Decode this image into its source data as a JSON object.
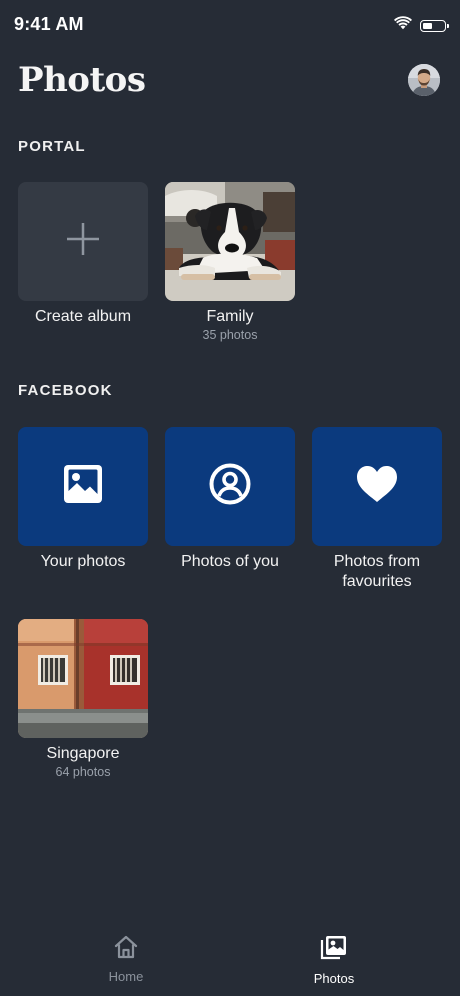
{
  "status_bar": {
    "time": "9:41 AM",
    "icons": [
      "wifi-icon",
      "battery-icon"
    ]
  },
  "header": {
    "title": "Photos",
    "avatar": "profile-avatar"
  },
  "portal": {
    "heading": "PORTAL",
    "tiles": [
      {
        "label": "Create album",
        "icon": "plus-icon"
      },
      {
        "label": "Family",
        "subtitle": "35 photos",
        "image": "dog-photo"
      }
    ]
  },
  "facebook": {
    "heading": "FACEBOOK",
    "tiles": [
      {
        "label": "Your photos",
        "icon": "image-icon"
      },
      {
        "label": "Photos of you",
        "icon": "person-circle-icon"
      },
      {
        "label": "Photos from favourites",
        "label_line1": "Photos from",
        "label_line2": "favourites",
        "icon": "heart-icon"
      },
      {
        "label": "Singapore",
        "subtitle": "64 photos",
        "image": "singapore-building-photo"
      }
    ]
  },
  "bottom_nav": {
    "items": [
      {
        "label": "Home",
        "icon": "home-icon",
        "active": false
      },
      {
        "label": "Photos",
        "icon": "photos-icon",
        "active": true
      }
    ]
  },
  "colors": {
    "background": "#262c36",
    "tile_blue": "#0b3a7e",
    "tile_empty": "#343a44",
    "muted_text": "#9aa1ab",
    "inactive_nav": "#8b929c"
  }
}
